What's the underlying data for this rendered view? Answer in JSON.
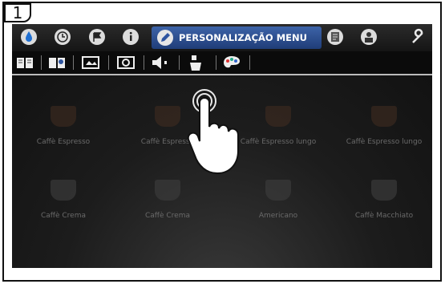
{
  "step": {
    "number": "1"
  },
  "topbar": {
    "icons": [
      "water-drop-icon",
      "clock-icon",
      "flag-icon",
      "info-icon"
    ],
    "active_tab": {
      "label": "PERSONALIZAÇÃO MENU",
      "icon": "pencil-icon"
    },
    "right_icons": [
      "document-icon",
      "user-lock-icon",
      "wrench-icon"
    ]
  },
  "subbar": {
    "icons": [
      "book-icon",
      "book-person-icon",
      "image-icon",
      "camera-icon",
      "speaker-icon",
      "cup-dispenser-icon",
      "palette-icon"
    ]
  },
  "drinks": [
    {
      "name": "Caffè Espresso"
    },
    {
      "name": "Caffè Espresso"
    },
    {
      "name": "Caffè Espresso lungo"
    },
    {
      "name": "Caffè Espresso lungo"
    },
    {
      "name": "Caffè Crema"
    },
    {
      "name": "Caffè Crema"
    },
    {
      "name": "Americano"
    },
    {
      "name": "Caffè Macchiato"
    }
  ],
  "colors": {
    "active_tab": "#2f55a0",
    "background": "#1a1a1a"
  }
}
